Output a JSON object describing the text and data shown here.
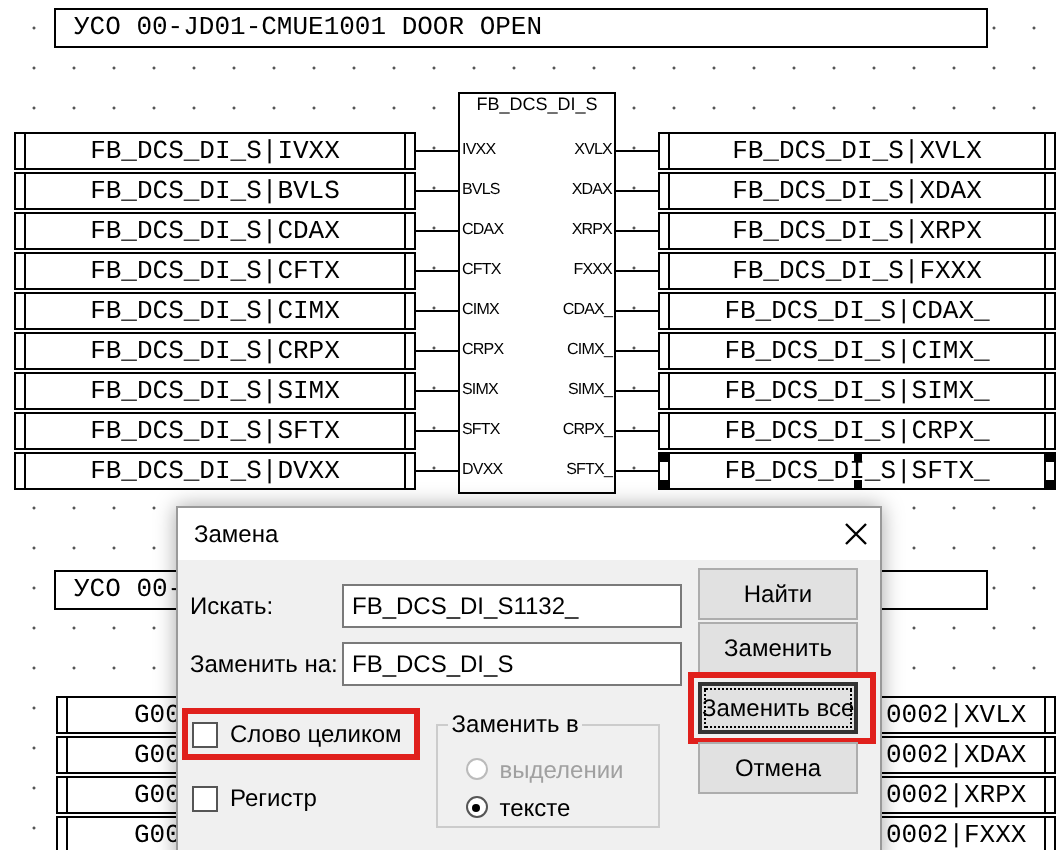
{
  "sheet_title": "УСО 00-JD01-CMUE1001 DOOR OPEN",
  "block": {
    "title": "FB_DCS_DI_S",
    "inputs": [
      "IVXX",
      "BVLS",
      "CDAX",
      "CFTX",
      "CIMX",
      "CRPX",
      "SIMX",
      "SFTX",
      "DVXX"
    ],
    "outputs": [
      "XVLX",
      "XDAX",
      "XRPX",
      "FXXX",
      "CDAX_",
      "CIMX_",
      "SIMX_",
      "CRPX_",
      "SFTX_"
    ]
  },
  "left_tags": [
    {
      "text": "FB_DCS_DI_S|IVXX"
    },
    {
      "text": "FB_DCS_DI_S|BVLS"
    },
    {
      "text": "FB_DCS_DI_S|CDAX"
    },
    {
      "text": "FB_DCS_DI_S|CFTX"
    },
    {
      "text": "FB_DCS_DI_S|CIMX"
    },
    {
      "text": "FB_DCS_DI_S|CRPX"
    },
    {
      "text": "FB_DCS_DI_S|SIMX"
    },
    {
      "text": "FB_DCS_DI_S|SFTX"
    },
    {
      "text": "FB_DCS_DI_S|DVXX"
    }
  ],
  "right_tags": [
    {
      "text": "FB_DCS_DI_S|XVLX",
      "selected": false
    },
    {
      "text": "FB_DCS_DI_S|XDAX",
      "selected": false
    },
    {
      "text": "FB_DCS_DI_S|XRPX",
      "selected": false
    },
    {
      "text": "FB_DCS_DI_S|FXXX",
      "selected": false
    },
    {
      "text": "FB_DCS_DI_S|CDAX_",
      "selected": false
    },
    {
      "text": "FB_DCS_DI_S|CIMX_",
      "selected": false
    },
    {
      "text": "FB_DCS_DI_S|SIMX_",
      "selected": false
    },
    {
      "text": "FB_DCS_DI_S|CRPX_",
      "selected": false
    },
    {
      "text": "FB_DCS_DI_S|SFTX_",
      "selected": true
    }
  ],
  "second_sheet_title": "УСО 00-",
  "second_left_tags": [
    "G00",
    "G00",
    "G00",
    "G00"
  ],
  "second_right_tags": [
    "0002|XVLX",
    "0002|XDAX",
    "0002|XRPX",
    "0002|FXXX"
  ],
  "dialog": {
    "title": "Замена",
    "fields": [
      {
        "label": "Искать:",
        "value": "FB_DCS_DI_S1132_"
      },
      {
        "label": "Заменить на:",
        "value": "FB_DCS_DI_S"
      }
    ],
    "options": [
      {
        "label": "Слово целиком",
        "checked": false,
        "highlighted": true
      },
      {
        "label": "Регистр",
        "checked": false,
        "highlighted": false
      }
    ],
    "scope": {
      "title": "Заменить в",
      "radios": [
        {
          "label": "выделении",
          "selected": false,
          "disabled": true
        },
        {
          "label": "тексте",
          "selected": true,
          "disabled": false
        }
      ]
    },
    "buttons": [
      {
        "label": "Найти",
        "focused": false,
        "highlighted": false
      },
      {
        "label": "Заменить",
        "focused": false,
        "highlighted": false
      },
      {
        "label": "Заменить все",
        "focused": true,
        "highlighted": true
      },
      {
        "label": "Отмена",
        "focused": false,
        "highlighted": false
      }
    ]
  }
}
